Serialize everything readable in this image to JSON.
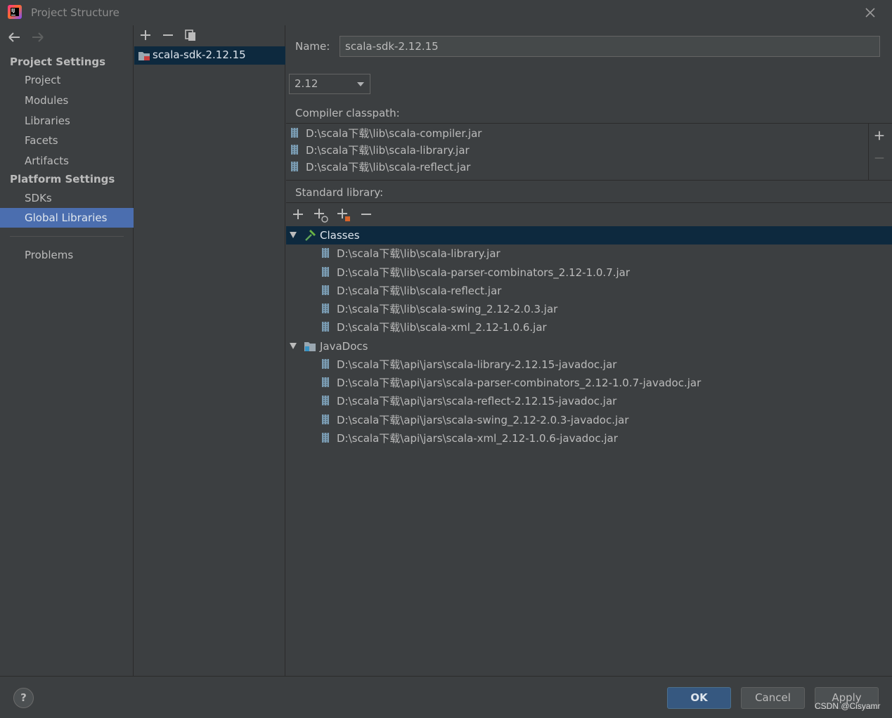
{
  "window": {
    "title": "Project Structure"
  },
  "sidebar": {
    "project_settings_title": "Project Settings",
    "project_items": [
      {
        "label": "Project"
      },
      {
        "label": "Modules"
      },
      {
        "label": "Libraries"
      },
      {
        "label": "Facets"
      },
      {
        "label": "Artifacts"
      }
    ],
    "platform_settings_title": "Platform Settings",
    "platform_items": [
      {
        "label": "SDKs"
      },
      {
        "label": "Global Libraries"
      }
    ],
    "selected": "Global Libraries",
    "problems_label": "Problems"
  },
  "library_list": {
    "items": [
      {
        "label": "scala-sdk-2.12.15"
      }
    ]
  },
  "detail": {
    "name_label": "Name:",
    "name_value": "scala-sdk-2.12.15",
    "version_value": "2.12",
    "compiler_classpath_label": "Compiler classpath:",
    "compiler_classpath": [
      "D:\\scala下载\\lib\\scala-compiler.jar",
      "D:\\scala下载\\lib\\scala-library.jar",
      "D:\\scala下载\\lib\\scala-reflect.jar"
    ],
    "standard_library_label": "Standard library:",
    "classes_label": "Classes",
    "classes": [
      "D:\\scala下载\\lib\\scala-library.jar",
      "D:\\scala下载\\lib\\scala-parser-combinators_2.12-1.0.7.jar",
      "D:\\scala下载\\lib\\scala-reflect.jar",
      "D:\\scala下载\\lib\\scala-swing_2.12-2.0.3.jar",
      "D:\\scala下载\\lib\\scala-xml_2.12-1.0.6.jar"
    ],
    "javadocs_label": "JavaDocs",
    "javadocs": [
      "D:\\scala下载\\api\\jars\\scala-library-2.12.15-javadoc.jar",
      "D:\\scala下载\\api\\jars\\scala-parser-combinators_2.12-1.0.7-javadoc.jar",
      "D:\\scala下载\\api\\jars\\scala-reflect-2.12.15-javadoc.jar",
      "D:\\scala下载\\api\\jars\\scala-swing_2.12-2.0.3-javadoc.jar",
      "D:\\scala下载\\api\\jars\\scala-xml_2.12-1.0.6-javadoc.jar"
    ]
  },
  "footer": {
    "help_label": "?",
    "ok_label": "OK",
    "cancel_label": "Cancel",
    "apply_label": "Apply",
    "watermark": "CSDN @Cisyamr"
  },
  "colors": {
    "background": "#3c3f41",
    "selection": "#4b6eaf",
    "tree_selection": "#0d293e",
    "ok_button": "#365880"
  }
}
